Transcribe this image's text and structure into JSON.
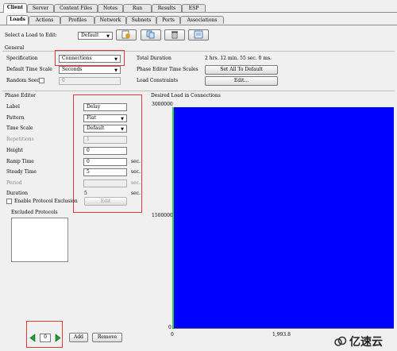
{
  "top_tabs": [
    "Client",
    "Server",
    "Content Files",
    "Notes",
    "Run",
    "Results",
    "ESP"
  ],
  "sub_tabs": [
    "Loads",
    "Actions",
    "Profiles",
    "Network",
    "Subnets",
    "Ports",
    "Associations"
  ],
  "load_select": {
    "label": "Select a Load to Edit:",
    "value": "Default"
  },
  "toolbar_icons": [
    "new-load-icon",
    "copy-load-icon",
    "delete-load-icon",
    "properties-icon"
  ],
  "general": {
    "title": "General",
    "specification_label": "Specification",
    "specification_value": "Connections",
    "time_scale_label": "Default Time Scale",
    "time_scale_value": "Seconds",
    "random_seed_label": "Random Seed",
    "random_seed_value": "0",
    "total_duration_label": "Total Duration",
    "total_duration_value": "2 hrs. 12 min. 55 sec. 0 ms.",
    "phase_editor_time_scales_label": "Phase Editor Time Scales",
    "set_all_default_button": "Set All To Default",
    "load_constraints_label": "Load Constraints",
    "edit_button": "Edit..."
  },
  "phase_editor": {
    "title": "Phase Editor",
    "label_label": "Label",
    "label_value": "Delay",
    "pattern_label": "Pattern",
    "pattern_value": "Flat",
    "time_scale_label": "Time Scale",
    "time_scale_value": "Default",
    "repetitions_label": "Repetitions",
    "repetitions_value": "1",
    "height_label": "Height",
    "height_value": "0",
    "ramp_time_label": "Ramp Time",
    "ramp_time_value": "0",
    "steady_time_label": "Steady Time",
    "steady_time_value": "5",
    "period_label": "Period",
    "period_value": "",
    "duration_label": "Duration",
    "duration_value": "5",
    "unit_sec": "sec.",
    "enable_exclusion_label": "Enable Protocol Exclusion",
    "edit_button": "Edit",
    "excluded_protocols_label": "Excluded Protocols"
  },
  "chart": {
    "title": "Desired Load in Connections",
    "y_ticks": [
      "3000000",
      "1500000",
      "0"
    ],
    "x_ticks": [
      "0",
      "1,993.8"
    ],
    "fill_color": "#0000ff",
    "line_color": "#2ecc40"
  },
  "phase_nav": {
    "index": "0",
    "add_button": "Add",
    "remove_button": "Remove"
  },
  "watermark": "亿速云",
  "chart_data": {
    "type": "area",
    "title": "Desired Load in Connections",
    "xlabel": "",
    "ylabel": "",
    "y_ticks": [
      0,
      1500000,
      3000000
    ],
    "x_ticks": [
      0,
      1993.8
    ],
    "ylim": [
      0,
      3000000
    ],
    "grid": false
  }
}
